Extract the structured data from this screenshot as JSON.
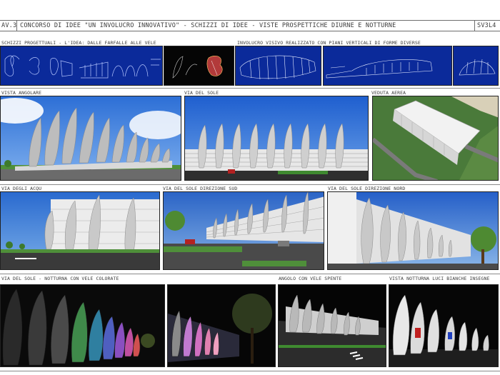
{
  "header": {
    "left_code": "AV.3",
    "title": "CONCORSO DI IDEE \"UN INVOLUCRO INNOVATIVO\" - SCHIZZI DI IDEE - VISTE PROSPETTICHE DIURNE E NOTTURNE",
    "right_code": "SV3L4"
  },
  "row1": {
    "caption_sketches": "SCHIZZI PROGETTUALI - L'IDEA: DALLE FARFALLE ALLE VELE",
    "caption_involucro": "INVOLUCRO VISIVO REALIZZATO CON PIANI VERTICALI DI FORME DIVERSE"
  },
  "row2": {
    "caption_angolare": "VISTA ANGOLARE",
    "caption_via_sole": "VIA DEL SOLE",
    "caption_aerea": "VEDUTA AEREA"
  },
  "row3": {
    "caption_acque": "VIA DEGLI ACQU",
    "caption_sud": "VIA DEL SOLE DIREZIONE SUD",
    "caption_nord": "VIA DEL SOLE DIREZIONE NORD"
  },
  "row4": {
    "caption_notturna": "VIA DEL SOLE - NOTTURNA CON VELE COLORATE",
    "caption_spente": "ANGOLO CON VELE SPENTE",
    "caption_bianche": "VISTA NOTTURNA LUCI BIANCHE INSEGNE"
  },
  "colors": {
    "blueprint": "#0b2a9a",
    "sky_day": "#3f7fd9",
    "night": "#0a0a0a",
    "ground": "#3a3a3a",
    "grass": "#4f8f3a"
  }
}
